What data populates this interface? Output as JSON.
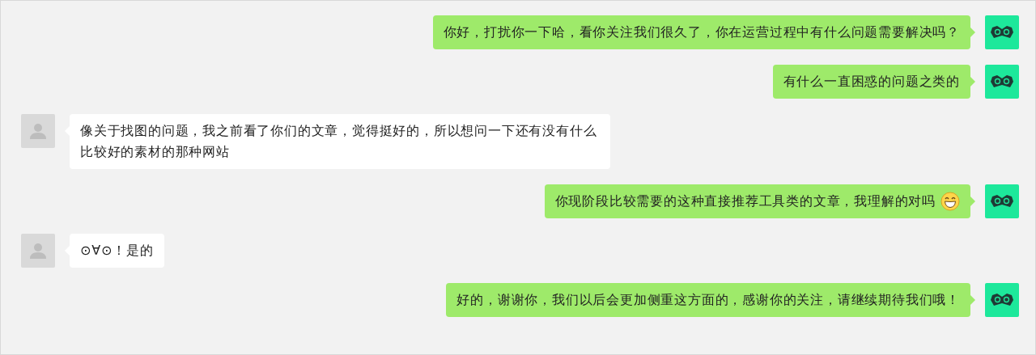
{
  "messages": [
    {
      "kind": "sent",
      "text": "你好，打扰你一下哈，看你关注我们很久了，你在运营过程中有什么问题需要解决吗？",
      "emoji": false
    },
    {
      "kind": "sent",
      "text": "有什么一直困惑的问题之类的",
      "emoji": false
    },
    {
      "kind": "received",
      "text": "像关于找图的问题，我之前看了你们的文章，觉得挺好的，所以想问一下还有没有什么比较好的素材的那种网站",
      "emoji": false
    },
    {
      "kind": "sent",
      "text": "你现阶段比较需要的这种直接推荐工具类的文章，我理解的对吗",
      "emoji": true
    },
    {
      "kind": "received",
      "text": "⊙∀⊙！是的",
      "emoji": false
    },
    {
      "kind": "sent",
      "text": "好的，谢谢你，我们以后会更加侧重这方面的，感谢你的关注，请继续期待我们哦！",
      "emoji": false
    }
  ]
}
